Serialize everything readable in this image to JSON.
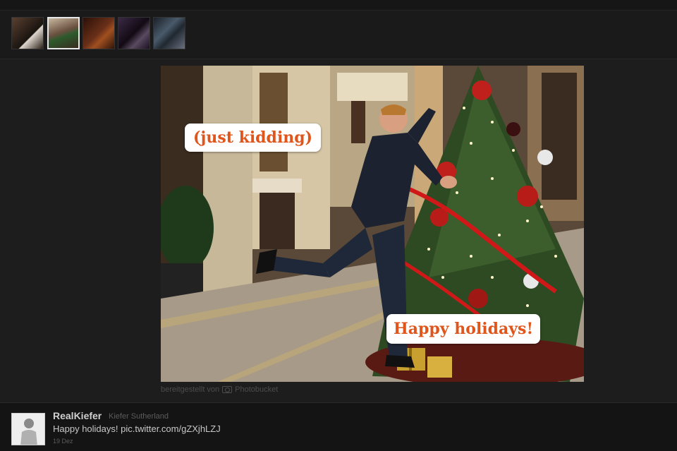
{
  "thumbnails": [
    {
      "name": "thumb-1",
      "color": "#3a2c20",
      "active": false
    },
    {
      "name": "thumb-2",
      "color": "#6b5a4a",
      "active": true
    },
    {
      "name": "thumb-3",
      "color": "#3a1c10",
      "active": false
    },
    {
      "name": "thumb-4",
      "color": "#2a1a2a",
      "active": false
    },
    {
      "name": "thumb-5",
      "color": "#2c3440",
      "active": false
    }
  ],
  "photo": {
    "caption_top": "(just kidding)",
    "caption_bottom": "Happy holidays!",
    "caption_color": "#e0551c"
  },
  "provided_by": {
    "prefix": "bereitgestellt von",
    "service": "Photobucket"
  },
  "tweet": {
    "username": "RealKiefer",
    "realname": "Kiefer Sutherland",
    "text": "Happy holidays!",
    "link": "pic.twitter.com/gZXjhLZJ",
    "date": "19 Dez"
  }
}
